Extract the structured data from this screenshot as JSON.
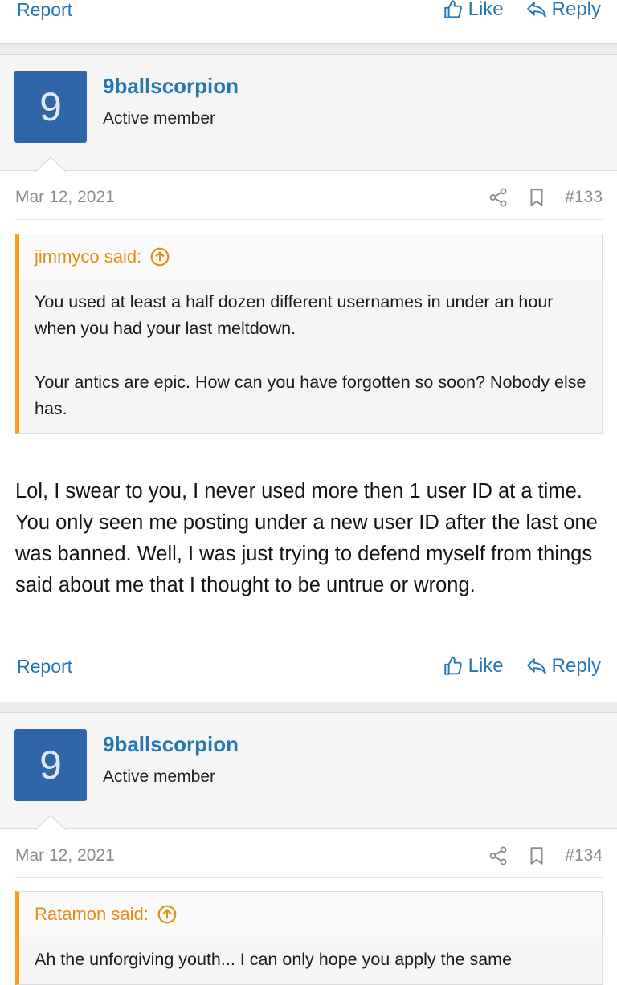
{
  "top_actions": {
    "report": "Report",
    "like": "Like",
    "reply": "Reply"
  },
  "posts": [
    {
      "avatar_letter": "9",
      "username": "9ballscorpion",
      "user_title": "Active member",
      "date": "Mar 12, 2021",
      "post_number": "#133",
      "quote_author": "jimmyco said:",
      "quote_paragraphs": [
        "You used at least a half dozen different usernames in under an hour when you had your last meltdown.",
        "Your antics are epic. How can you have forgotten so soon? Nobody else has."
      ],
      "message": "Lol, I swear to you, I never used more then 1 user ID at a time. You only seen me posting under a new user ID after the last one was banned. Well, I was just trying to defend myself from things said about me that I thought to be untrue or wrong.",
      "actions": {
        "report": "Report",
        "like": "Like",
        "reply": "Reply"
      }
    },
    {
      "avatar_letter": "9",
      "username": "9ballscorpion",
      "user_title": "Active member",
      "date": "Mar 12, 2021",
      "post_number": "#134",
      "quote_author": "Ratamon said:",
      "quote_paragraphs": [
        "Ah the unforgiving youth... I can only hope you apply the same"
      ]
    }
  ],
  "colors": {
    "link": "#2577b1",
    "quote_accent": "#f1a01f",
    "avatar_bg": "#2f66a7"
  }
}
